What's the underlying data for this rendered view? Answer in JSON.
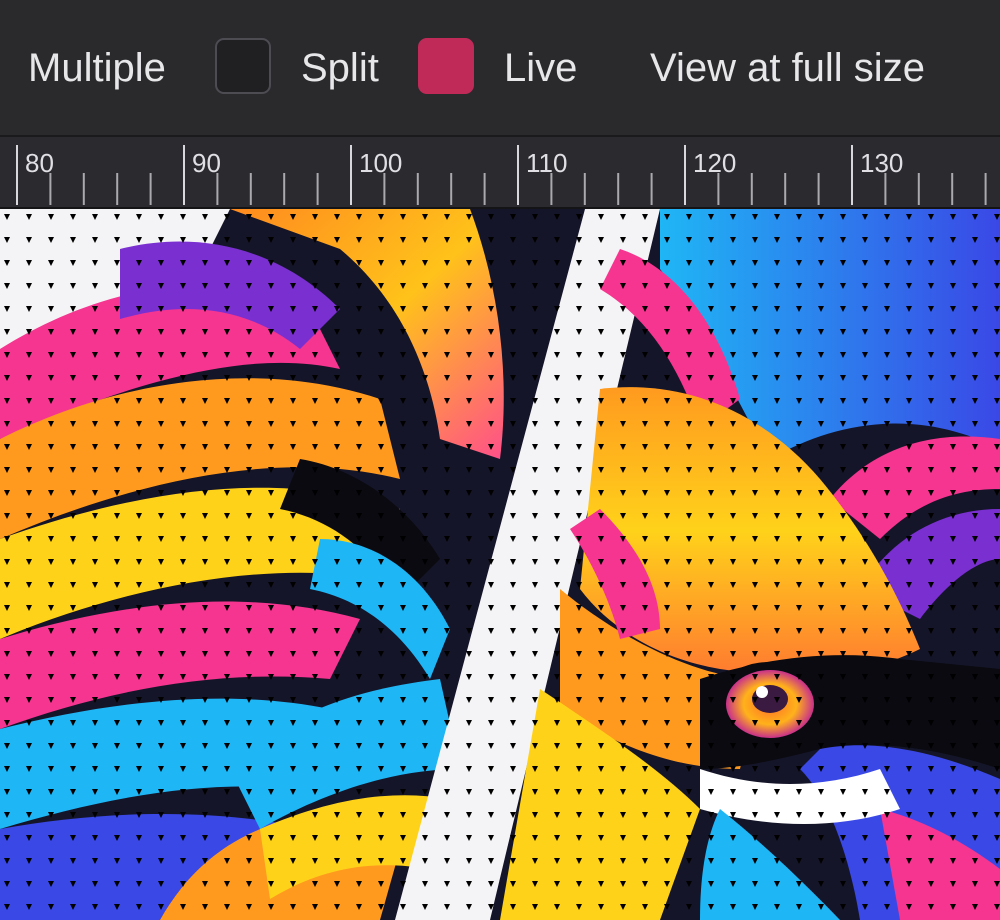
{
  "toolbar": {
    "multiple_label": "Multiple",
    "split_label": "Split",
    "live_label": "Live",
    "view_full_size_label": "View at full size",
    "multiple_swatch_color": "#202023",
    "split_swatch_color": "#c02a58"
  },
  "ruler": {
    "labels": [
      "80",
      "90",
      "100",
      "110",
      "120",
      "130"
    ],
    "start_value": 80,
    "end_value": 130,
    "major_step": 10,
    "minor_step": 2
  },
  "canvas": {
    "content": "pop-art lion face artwork with halftone dot pattern",
    "palette": [
      "#f5358f",
      "#ff9a1f",
      "#ffd21a",
      "#1fb6f5",
      "#3a48e6",
      "#7a2fd0",
      "#ffffff",
      "#0a0a10"
    ]
  }
}
